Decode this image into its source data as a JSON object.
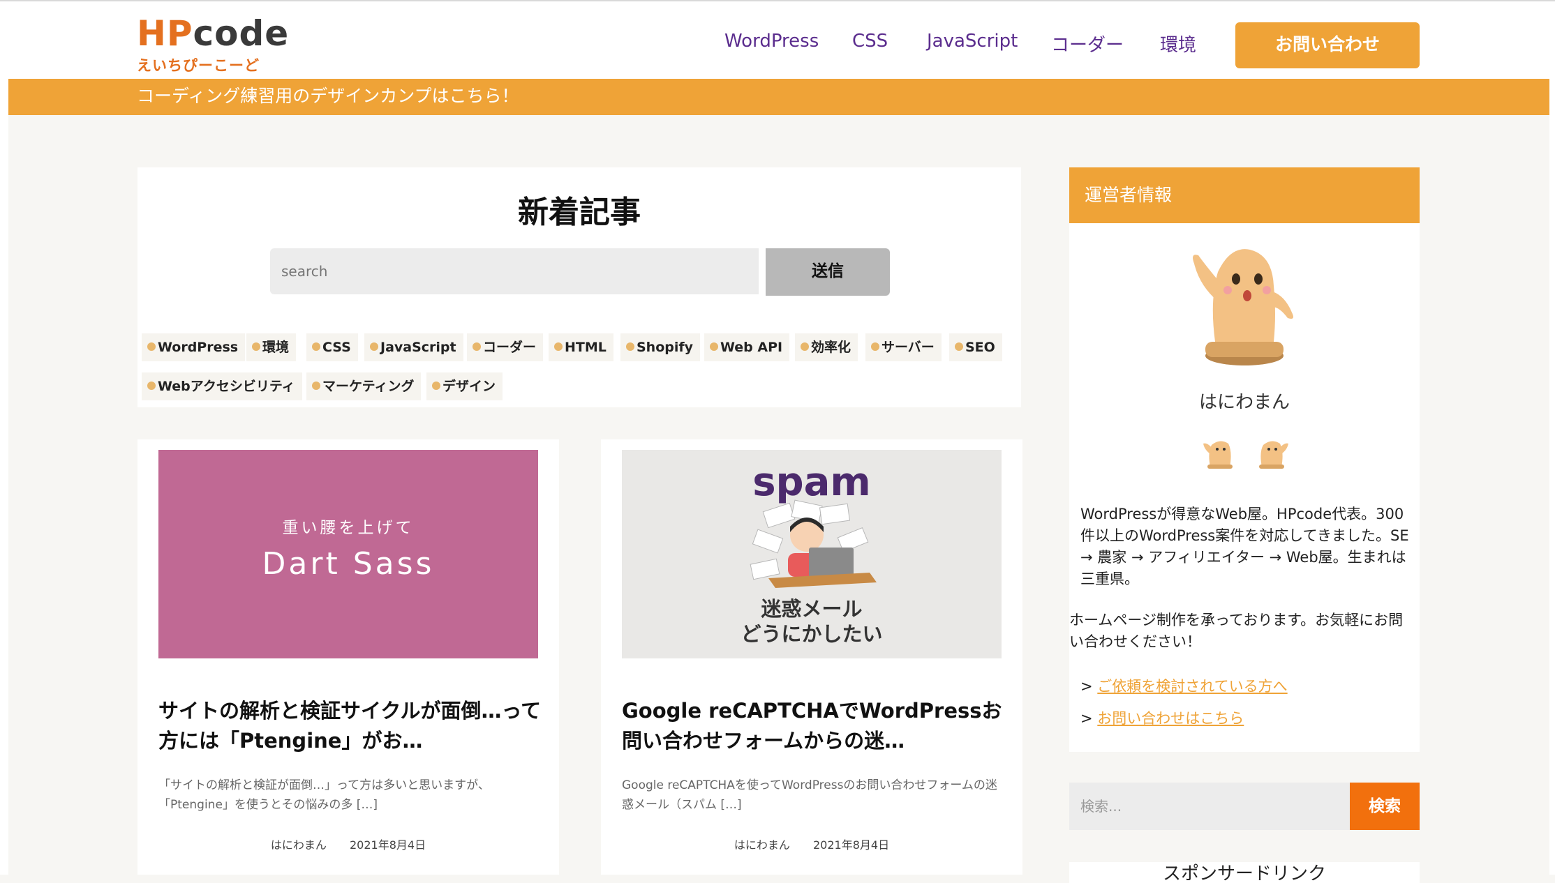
{
  "logo": {
    "brand_hp": "HP",
    "brand_code": "code",
    "subtitle": "えいちぴーこーど"
  },
  "nav": {
    "items": [
      "WordPress",
      "CSS",
      "JavaScript",
      "コーダー",
      "環境"
    ],
    "contact": "お問い合わせ"
  },
  "banner": {
    "text": "コーディング練習用のデザインカンプはこちら！"
  },
  "new_articles": {
    "title": "新着記事",
    "search_placeholder": "search",
    "submit": "送信",
    "tags": [
      "WordPress",
      "環境",
      "CSS",
      "JavaScript",
      "コーダー",
      "HTML",
      "Shopify",
      "Web API",
      "効率化",
      "サーバー",
      "SEO",
      "Webアクセシビリティ",
      "マーケティング",
      "デザイン"
    ]
  },
  "posts": [
    {
      "thumb_small": "重い腰を上げて",
      "thumb_big": "Dart Sass",
      "title": "サイトの解析と検証サイクルが面倒…って方には「Ptengine」がお…",
      "excerpt": "「サイトの解析と検証が面倒…」って方は多いと思いますが、「Ptengine」を使うとその悩みの多 […]",
      "author": "はにわまん",
      "date": "2021年8月4日"
    },
    {
      "thumb_top": "spam",
      "thumb_line1": "迷惑メール",
      "thumb_line2": "どうにかしたい",
      "title": "Google reCAPTCHAでWordPressお問い合わせフォームからの迷…",
      "excerpt": "Google reCAPTCHAを使ってWordPressのお問い合わせフォームの迷惑メール（スパム […]",
      "author": "はにわまん",
      "date": "2021年8月4日"
    }
  ],
  "sidebar": {
    "owner_heading": "運営者情報",
    "owner_name": "はにわまん",
    "bio1": "WordPressが得意なWeb屋。HPcode代表。300件以上のWordPress案件を対応してきました。SE → 農家 → アフィリエイター → Web屋。生まれは三重県。",
    "bio2": "ホームページ制作を承っております。お気軽にお問い合わせください！",
    "link_prefix": ">",
    "link1": "ご依頼を検討されている方へ",
    "link2": "お問い合わせはこちら",
    "search_placeholder": "検索...",
    "search_button": "検索",
    "sponsor": "スポンサードリンク"
  },
  "colors": {
    "accent": "#efa337",
    "nav_text": "#5b2d8e",
    "logo_orange": "#e4701f",
    "search_btn": "#f2700d",
    "thumb_pink": "#c06994"
  }
}
